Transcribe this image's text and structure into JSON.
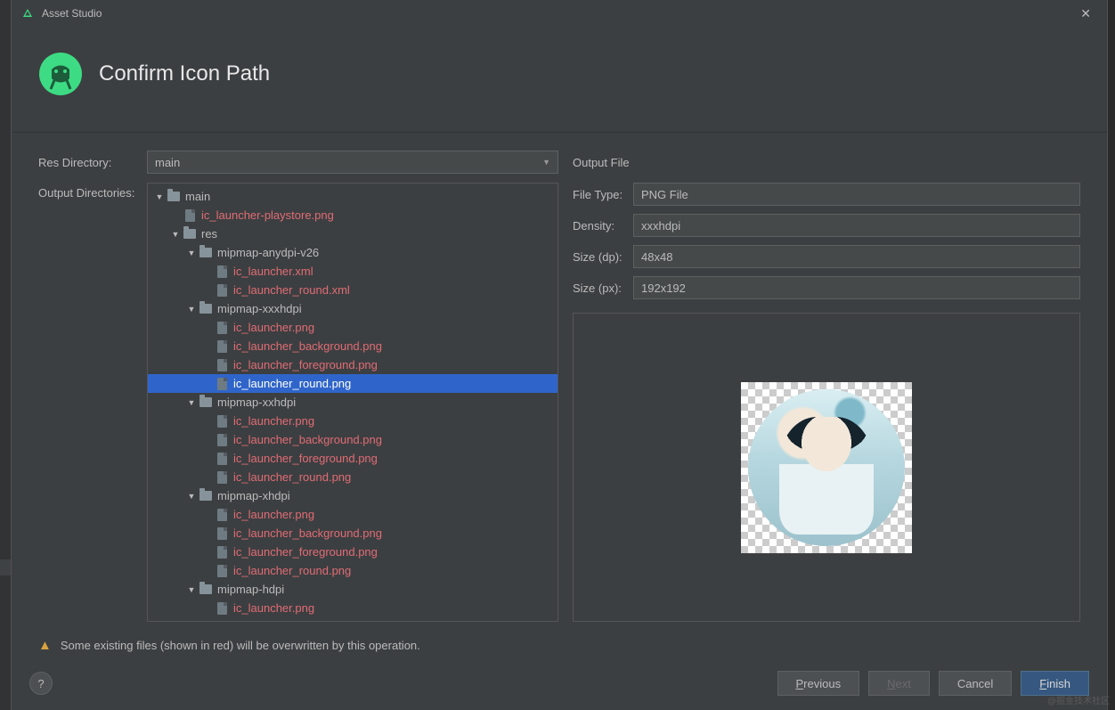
{
  "window": {
    "title": "Asset Studio"
  },
  "header": {
    "title": "Confirm Icon Path"
  },
  "labels": {
    "resDirectory": "Res Directory:",
    "outputDirectories": "Output Directories:",
    "outputFile": "Output File",
    "fileType": "File Type:",
    "density": "Density:",
    "sizeDp": "Size (dp):",
    "sizePx": "Size (px):"
  },
  "resDirectory": {
    "selected": "main"
  },
  "tree": [
    {
      "depth": 0,
      "kind": "folder",
      "expanded": true,
      "label": "main",
      "overwrite": false
    },
    {
      "depth": 1,
      "kind": "file",
      "label": "ic_launcher-playstore.png",
      "overwrite": true
    },
    {
      "depth": 1,
      "kind": "folder",
      "expanded": true,
      "label": "res",
      "overwrite": false
    },
    {
      "depth": 2,
      "kind": "folder",
      "expanded": true,
      "label": "mipmap-anydpi-v26",
      "overwrite": false
    },
    {
      "depth": 3,
      "kind": "file",
      "label": "ic_launcher.xml",
      "overwrite": true
    },
    {
      "depth": 3,
      "kind": "file",
      "label": "ic_launcher_round.xml",
      "overwrite": true
    },
    {
      "depth": 2,
      "kind": "folder",
      "expanded": true,
      "label": "mipmap-xxxhdpi",
      "overwrite": false
    },
    {
      "depth": 3,
      "kind": "file",
      "label": "ic_launcher.png",
      "overwrite": true
    },
    {
      "depth": 3,
      "kind": "file",
      "label": "ic_launcher_background.png",
      "overwrite": true
    },
    {
      "depth": 3,
      "kind": "file",
      "label": "ic_launcher_foreground.png",
      "overwrite": true
    },
    {
      "depth": 3,
      "kind": "file",
      "label": "ic_launcher_round.png",
      "overwrite": true,
      "selected": true
    },
    {
      "depth": 2,
      "kind": "folder",
      "expanded": true,
      "label": "mipmap-xxhdpi",
      "overwrite": false
    },
    {
      "depth": 3,
      "kind": "file",
      "label": "ic_launcher.png",
      "overwrite": true
    },
    {
      "depth": 3,
      "kind": "file",
      "label": "ic_launcher_background.png",
      "overwrite": true
    },
    {
      "depth": 3,
      "kind": "file",
      "label": "ic_launcher_foreground.png",
      "overwrite": true
    },
    {
      "depth": 3,
      "kind": "file",
      "label": "ic_launcher_round.png",
      "overwrite": true
    },
    {
      "depth": 2,
      "kind": "folder",
      "expanded": true,
      "label": "mipmap-xhdpi",
      "overwrite": false
    },
    {
      "depth": 3,
      "kind": "file",
      "label": "ic_launcher.png",
      "overwrite": true
    },
    {
      "depth": 3,
      "kind": "file",
      "label": "ic_launcher_background.png",
      "overwrite": true
    },
    {
      "depth": 3,
      "kind": "file",
      "label": "ic_launcher_foreground.png",
      "overwrite": true
    },
    {
      "depth": 3,
      "kind": "file",
      "label": "ic_launcher_round.png",
      "overwrite": true
    },
    {
      "depth": 2,
      "kind": "folder",
      "expanded": true,
      "label": "mipmap-hdpi",
      "overwrite": false
    },
    {
      "depth": 3,
      "kind": "file",
      "label": "ic_launcher.png",
      "overwrite": true
    }
  ],
  "outputFile": {
    "fileType": "PNG File",
    "density": "xxxhdpi",
    "sizeDp": "48x48",
    "sizePx": "192x192"
  },
  "warning": "Some existing files (shown in red) will be overwritten by this operation.",
  "buttons": {
    "previous": "Previous",
    "next": "Next",
    "cancel": "Cancel",
    "finish": "Finish",
    "help": "?"
  },
  "watermark": "@掘金技术社区"
}
